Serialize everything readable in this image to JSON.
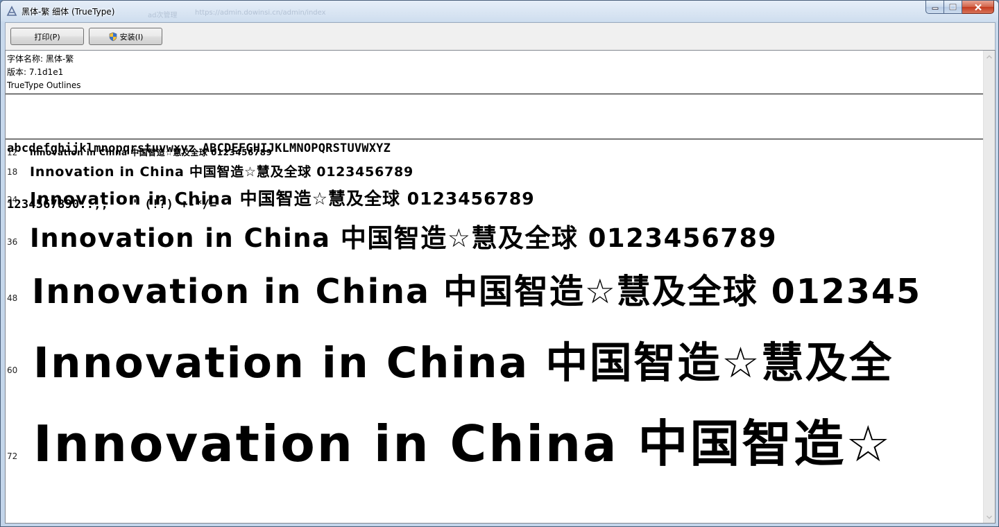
{
  "window": {
    "title": "黑体-繁 细体 (TrueType)",
    "icon": "font-viewer-icon",
    "ghost_tab": "ad次管理",
    "ghost_address": "https://admin.dowinsi.cn/admin/index"
  },
  "toolbar": {
    "print_label": "打印(P)",
    "install_label": "安装(I)"
  },
  "info": {
    "font_name": "字体名称: 黑体-繁",
    "version": "版本: 7.1d1e1",
    "outlines": "TrueType Outlines"
  },
  "charset": {
    "line1": "abcdefghijklmnopqrstuvwxyz ABCDEFGHIJKLMNOPQRSTUVWXYZ",
    "line2": "1234567890.:,; ' \" (!?) +-*/="
  },
  "samples": [
    {
      "size": "12",
      "text": "Innovation in China 中国智造☆慧及全球 0123456789"
    },
    {
      "size": "18",
      "text": "Innovation in China 中国智造☆慧及全球 0123456789"
    },
    {
      "size": "24",
      "text": "Innovation in China 中国智造☆慧及全球 0123456789"
    },
    {
      "size": "36",
      "text": "Innovation in China 中国智造☆慧及全球 0123456789"
    },
    {
      "size": "48",
      "text": "Innovation in China 中国智造☆慧及全球 012345"
    },
    {
      "size": "60",
      "text": "Innovation in China 中国智造☆慧及全"
    },
    {
      "size": "72",
      "text": "Innovation in China 中国智造☆"
    }
  ],
  "colors": {
    "title_bg": "#cfdeef",
    "close_button": "#c43b1f",
    "content_bg": "#ffffff"
  }
}
